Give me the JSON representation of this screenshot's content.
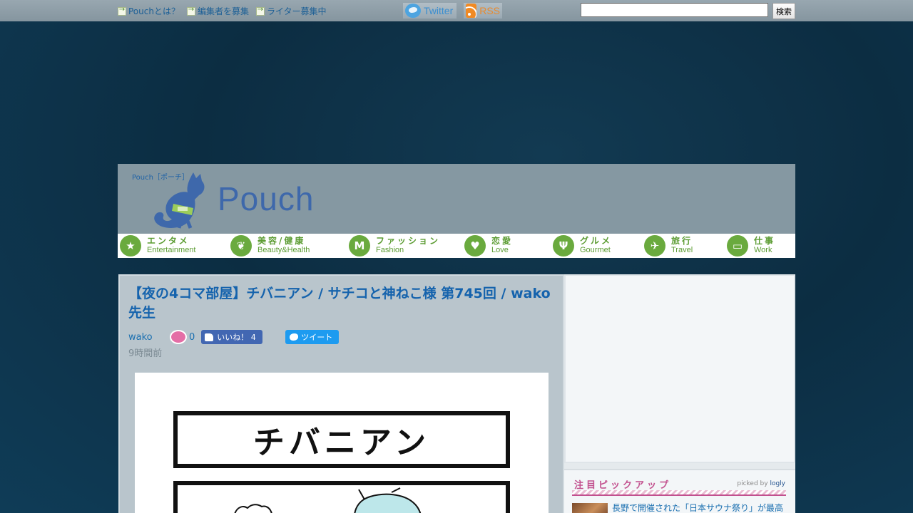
{
  "topbar": {
    "links": [
      "Pouchとは？",
      "編集者を募集",
      "ライター募集中"
    ],
    "twitter_label": "Twitter",
    "rss_label": "RSS",
    "search_value": "",
    "search_button": "検索"
  },
  "header": {
    "logo_small": "Pouch［ポーチ］",
    "logo_word": "Pouch"
  },
  "nav": [
    {
      "jp": "エンタメ",
      "en": "Entertainment",
      "icon": "star-icon"
    },
    {
      "jp": "美容/健康",
      "en": "Beauty&Health",
      "icon": "leaf-icon"
    },
    {
      "jp": "ファッション",
      "en": "Fashion",
      "icon": "fashion-icon"
    },
    {
      "jp": "恋愛",
      "en": "Love",
      "icon": "heart-icon"
    },
    {
      "jp": "グルメ",
      "en": "Gourmet",
      "icon": "fork-icon"
    },
    {
      "jp": "旅行",
      "en": "Travel",
      "icon": "plane-icon"
    },
    {
      "jp": "仕事",
      "en": "Work",
      "icon": "card-icon"
    }
  ],
  "article": {
    "title": "【夜の4コマ部屋】チバニアン / サチコと神ねこ様 第745回 / wako先生",
    "author": "wako",
    "comment_count": "0",
    "like_label": "いいね！ 4",
    "tweet_label": "ツイート",
    "timestamp": "9時間前",
    "comic_title": "チバニアン"
  },
  "sidebar": {
    "pickup_title": "注目ピックアップ",
    "picked_by_prefix": "picked by",
    "picked_by_brand": "logly",
    "pickup_item_text": "長野で開催された「日本サウナ祭り」が最高"
  },
  "colors": {
    "link": "#1a6fb0",
    "category_green": "#6aaa3e",
    "pickup_pink": "#c2508e"
  }
}
